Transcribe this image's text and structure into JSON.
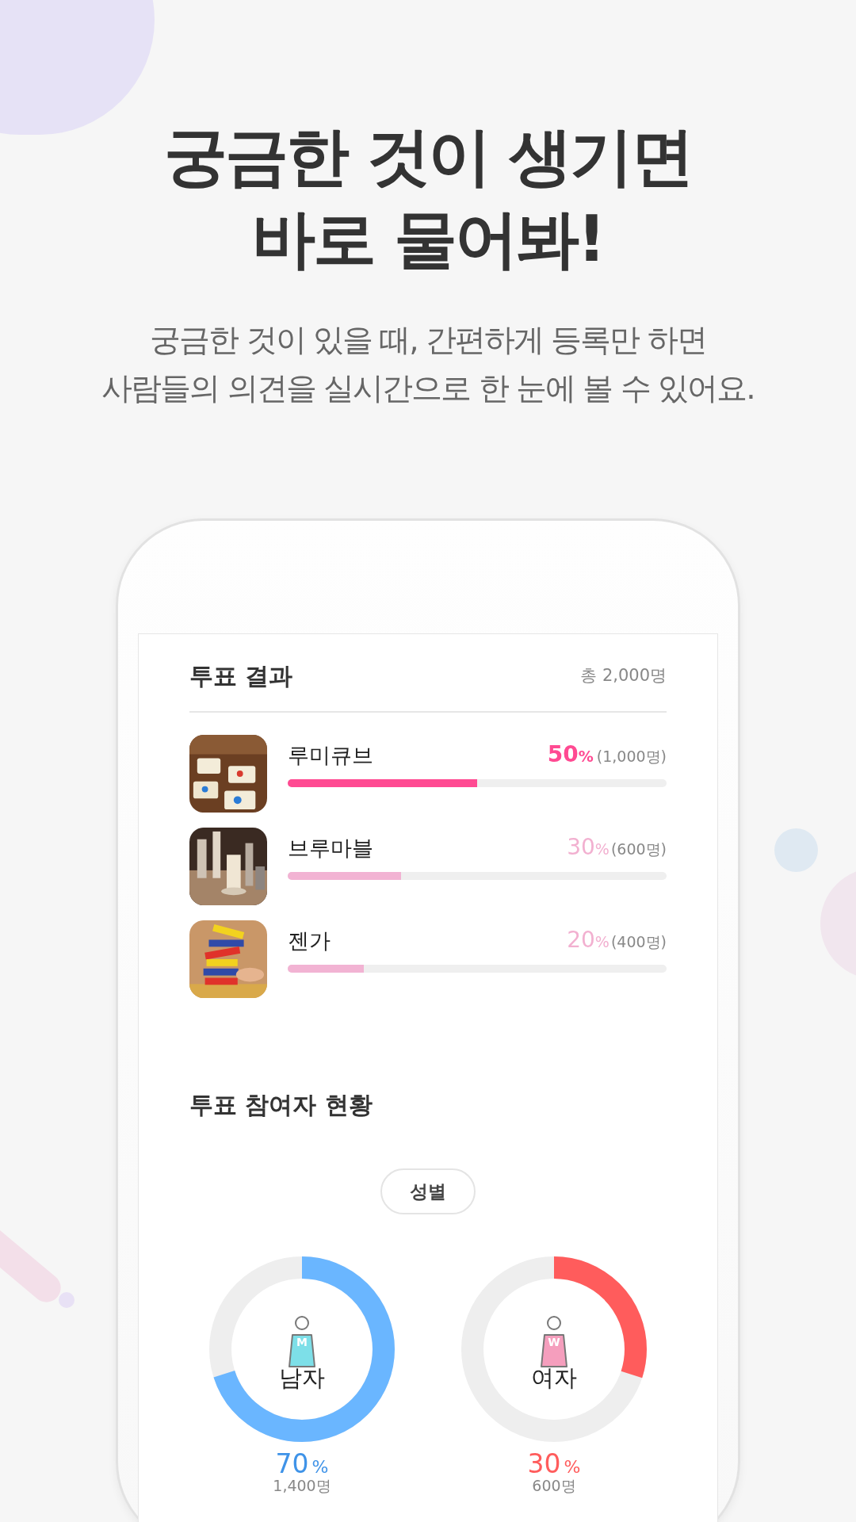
{
  "headline": [
    "궁금한 것이 생기면",
    "바로 물어봐!"
  ],
  "subtitle": [
    "궁금한 것이 있을 때, 간편하게 등록만 하면",
    "사람들의 의견을 실시간으로 한 눈에 볼 수 있어요."
  ],
  "results": {
    "title": "투표 결과",
    "total": "총 2,000명",
    "options": [
      {
        "label": "루미큐브",
        "percent": "50",
        "unit": "%",
        "count": "(1,000명)",
        "level": 0.5,
        "selected": true
      },
      {
        "label": "브루마블",
        "percent": "30",
        "unit": "%",
        "count": "(600명)",
        "level": 0.3,
        "selected": false
      },
      {
        "label": "젠가",
        "percent": "20",
        "unit": "%",
        "count": "(400명)",
        "level": 0.2,
        "selected": false
      }
    ]
  },
  "participants": {
    "title": "투표 참여자 현황",
    "filter": "성별",
    "groups": [
      {
        "kind": "male",
        "badge": "M",
        "label": "남자",
        "percent": "70",
        "unit": "%",
        "count": "1,400명",
        "color": "#6ab6ff"
      },
      {
        "kind": "female",
        "badge": "W",
        "label": "여자",
        "percent": "30",
        "unit": "%",
        "count": "600명",
        "color": "#ff5c5c"
      }
    ]
  }
}
